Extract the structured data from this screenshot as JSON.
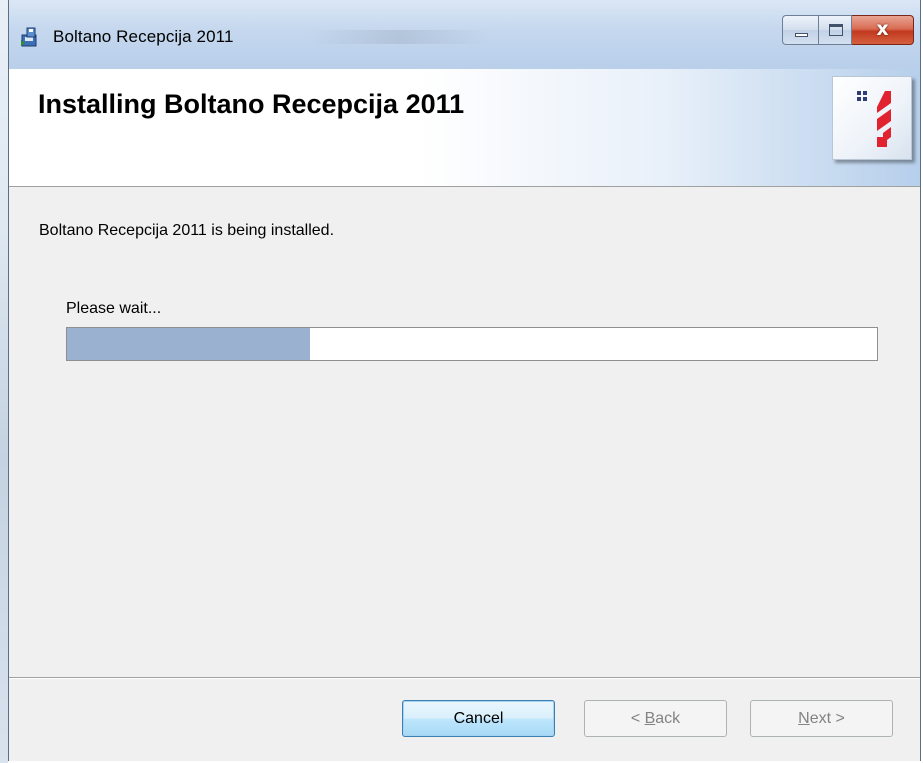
{
  "window": {
    "title": "Boltano  Recepcija 2011",
    "close_glyph": "x"
  },
  "banner": {
    "title": "Installing Boltano  Recepcija 2011"
  },
  "content": {
    "status": "Boltano  Recepcija 2011 is being installed.",
    "wait_label": "Please wait...",
    "progress": 0.3
  },
  "buttons": {
    "cancel": "Cancel",
    "back_prefix": "< ",
    "back_accel": "B",
    "back_rest": "ack",
    "next_accel": "N",
    "next_rest": "ext >"
  },
  "icons": {
    "app": "installer-app-icon",
    "logo": "boltano-logo-icon"
  },
  "colors": {
    "progress_fill": "#9ab1cf",
    "logo_red": "#e0232e",
    "logo_navy": "#2c3e73"
  }
}
